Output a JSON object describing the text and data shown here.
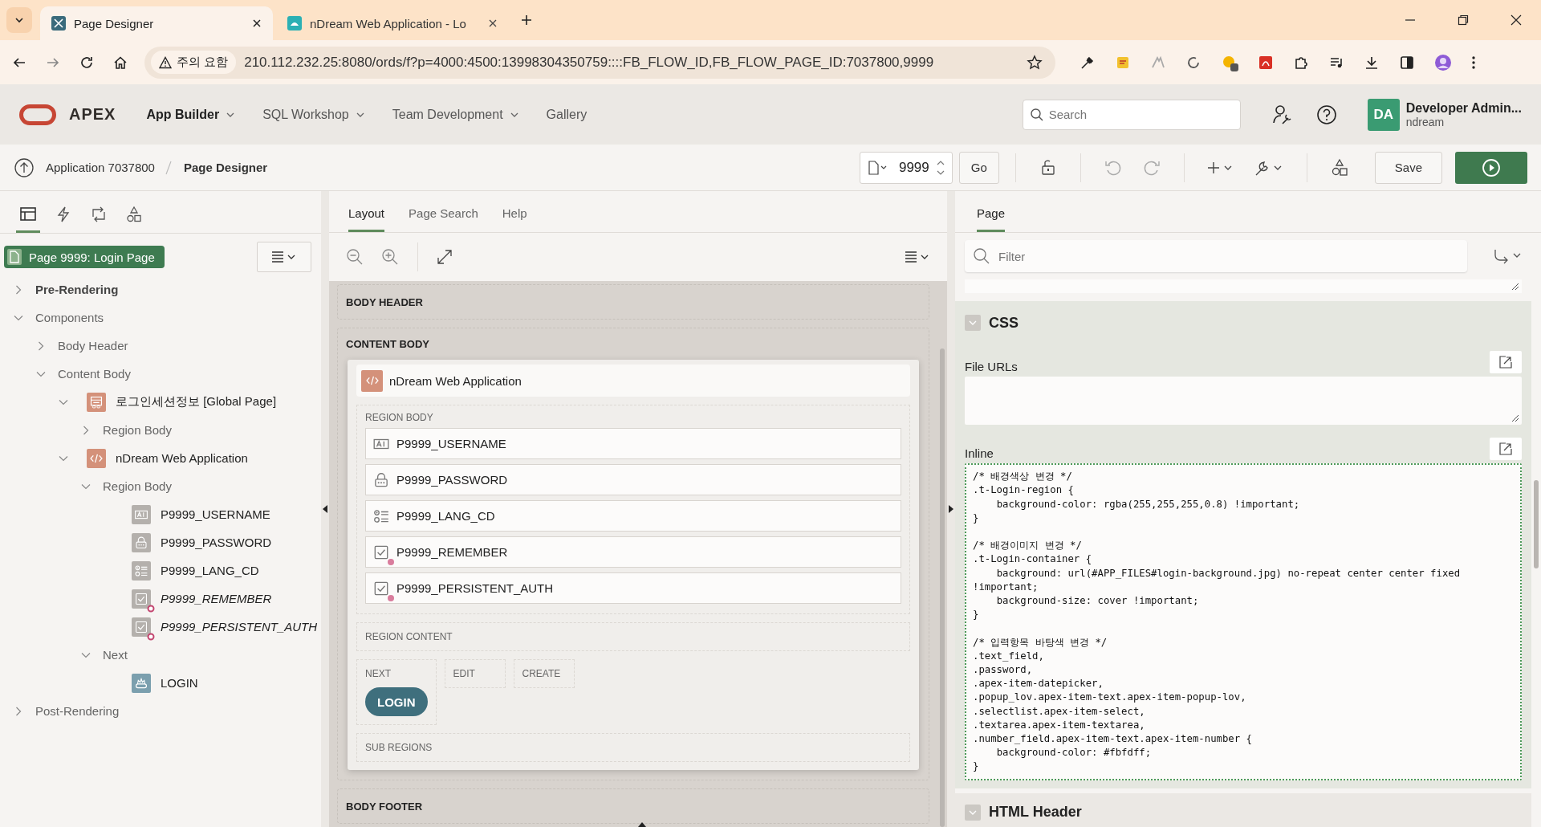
{
  "browser": {
    "tabs": [
      {
        "title": "Page Designer",
        "selected": true,
        "kind": "designer"
      },
      {
        "title": "nDream Web Application - Lo",
        "selected": false,
        "kind": "app"
      }
    ],
    "security_label": "주의 요함",
    "url": "210.112.232.25:8080/ords/f?p=4000:4500:13998304350759::::FB_FLOW_ID,FB_FLOW_PAGE_ID:7037800,9999"
  },
  "header": {
    "logo": "APEX",
    "nav": [
      {
        "label": "App Builder",
        "selected": true,
        "has_menu": true
      },
      {
        "label": "SQL Workshop",
        "selected": false,
        "has_menu": true
      },
      {
        "label": "Team Development",
        "selected": false,
        "has_menu": true
      },
      {
        "label": "Gallery",
        "selected": false,
        "has_menu": false
      }
    ],
    "search": {
      "placeholder": "Search"
    },
    "user": {
      "initials": "DA",
      "name": "Developer Admin...",
      "workspace": "ndream"
    }
  },
  "toolbar": {
    "breadcrumb": [
      "Application 7037800",
      "Page Designer"
    ],
    "page_number": "9999",
    "go": "Go",
    "save": "Save"
  },
  "left": {
    "icon_tabs": [
      {
        "kind": "tree",
        "selected": true
      },
      {
        "kind": "bolt",
        "selected": false
      },
      {
        "kind": "loop",
        "selected": false
      },
      {
        "kind": "shapes",
        "selected": false
      }
    ],
    "page_badge": "Page 9999: Login Page",
    "tree": [
      {
        "label": "Pre-Rendering",
        "expanded": false,
        "strong": true
      },
      {
        "label": "Components",
        "expanded": true,
        "strong": false,
        "children": [
          {
            "label": "Body Header",
            "expanded": false
          },
          {
            "label": "Content Body",
            "expanded": true,
            "children": [
              {
                "label": "로그인세션정보 [Global Page]",
                "kind": "static-region",
                "expanded": true,
                "children": [
                  {
                    "label": "Region Body",
                    "expanded": false
                  }
                ]
              },
              {
                "label": "nDream Web Application",
                "kind": "code-region",
                "expanded": true,
                "children": [
                  {
                    "label": "Region Body",
                    "expanded": true,
                    "children": [
                      {
                        "label": "P9999_USERNAME",
                        "kind": "text",
                        "conditional": false
                      },
                      {
                        "label": "P9999_PASSWORD",
                        "kind": "password",
                        "conditional": false
                      },
                      {
                        "label": "P9999_LANG_CD",
                        "kind": "radio",
                        "conditional": false
                      },
                      {
                        "label": "P9999_REMEMBER",
                        "kind": "checkbox",
                        "conditional": true
                      },
                      {
                        "label": "P9999_PERSISTENT_AUTH",
                        "kind": "checkbox",
                        "conditional": true
                      }
                    ]
                  },
                  {
                    "label": "Next",
                    "expanded": true,
                    "children": [
                      {
                        "label": "LOGIN",
                        "kind": "button",
                        "conditional": false
                      }
                    ]
                  }
                ]
              }
            ]
          }
        ]
      },
      {
        "label": "Post-Rendering",
        "expanded": false,
        "strong": false
      }
    ]
  },
  "middle": {
    "tabs": [
      {
        "label": "Layout",
        "selected": true
      },
      {
        "label": "Page Search",
        "selected": false
      },
      {
        "label": "Help",
        "selected": false
      }
    ],
    "body_header": "BODY HEADER",
    "content_body": "CONTENT BODY",
    "region": {
      "title": "nDream Web Application",
      "body_label": "REGION BODY",
      "items": [
        {
          "name": "P9999_USERNAME",
          "kind": "text",
          "conditional": false
        },
        {
          "name": "P9999_PASSWORD",
          "kind": "password",
          "conditional": false
        },
        {
          "name": "P9999_LANG_CD",
          "kind": "radio",
          "conditional": false
        },
        {
          "name": "P9999_REMEMBER",
          "kind": "checkbox",
          "conditional": true
        },
        {
          "name": "P9999_PERSISTENT_AUTH",
          "kind": "checkbox",
          "conditional": true
        }
      ],
      "content_label": "REGION CONTENT",
      "button_positions": [
        {
          "label": "NEXT",
          "buttons": [
            "LOGIN"
          ]
        },
        {
          "label": "EDIT"
        },
        {
          "label": "CREATE"
        }
      ],
      "sub_regions_label": "SUB REGIONS"
    },
    "body_footer": "BODY FOOTER"
  },
  "right": {
    "tabs": [
      {
        "label": "Page",
        "selected": true
      }
    ],
    "filter": {
      "placeholder": "Filter"
    },
    "css_group": {
      "title": "CSS",
      "expanded": true,
      "file_urls_label": "File URLs",
      "inline_label": "Inline",
      "inline_code": "/* 배경색상 변경 */\n.t-Login-region {\n    background-color: rgba(255,255,255,0.8) !important;\n}\n\n/* 배경이미지 변경 */\n.t-Login-container {\n    background: url(#APP_FILES#login-background.jpg) no-repeat center center fixed !important;\n    background-size: cover !important;\n}\n\n/* 입력항목 바탕색 변경 */\n.text_field,\n.password,\n.apex-item-datepicker,\n.popup_lov.apex-item-text.apex-item-popup-lov,\n.selectlist.apex-item-select,\n.textarea.apex-item-textarea,\n.number_field.apex-item-text.apex-item-number {\n    background-color: #fbfdff;\n}"
    },
    "next_group": {
      "title": "HTML Header",
      "expanded": true
    }
  }
}
